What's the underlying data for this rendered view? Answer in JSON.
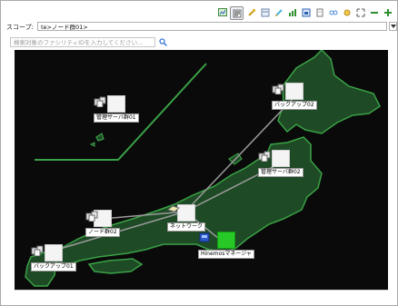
{
  "toolbar": {
    "icons": [
      "map-icon",
      "filter-icon",
      "wrench-icon",
      "list-icon",
      "pencil-icon",
      "chart-icon",
      "diagram-icon",
      "page-icon",
      "link-icon",
      "settings-icon",
      "fit-icon",
      "minus-icon",
      "plus-icon"
    ]
  },
  "scope": {
    "label": "スコープ:",
    "value": "te>ノード群01>"
  },
  "search": {
    "placeholder": "検索対象のファシリティIDを入力してください..."
  },
  "colors": {
    "land": "#1e4a25",
    "coast": "#3aa146",
    "link": "#9a9a9a",
    "manager": "#27c927",
    "background": "#0a0a0a"
  },
  "nodes": [
    {
      "label": "管理サーバ群01",
      "icon": "server-group-icon"
    },
    {
      "label": "バックアップ02",
      "icon": "server-group-icon"
    },
    {
      "label": "管理サーバ群02",
      "icon": "server-group-icon"
    },
    {
      "label": "ネットワーク",
      "icon": "network-icon"
    },
    {
      "label": "ノード群02",
      "icon": "server-group-icon"
    },
    {
      "label": "バックアップ01",
      "icon": "server-group-icon"
    },
    {
      "label": "Hinemosマネージャ",
      "icon": "manager-icon"
    }
  ]
}
